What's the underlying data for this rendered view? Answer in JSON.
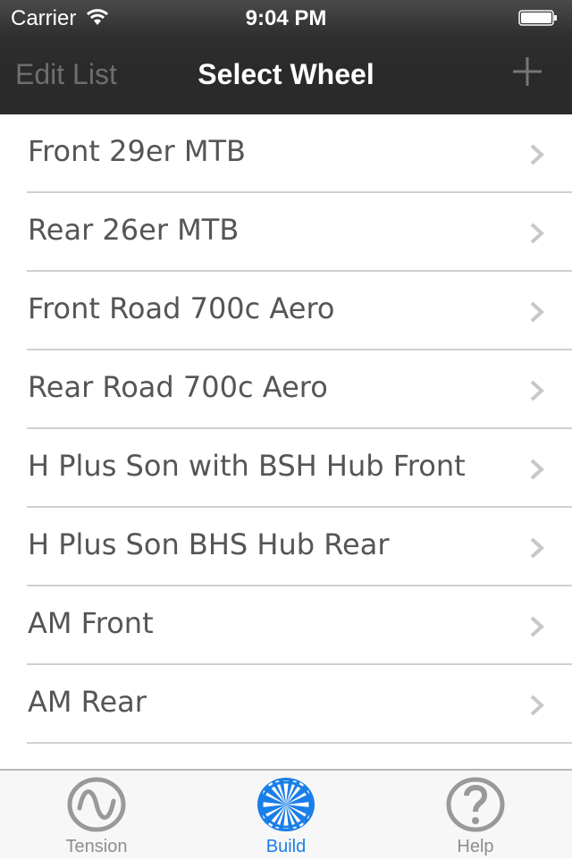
{
  "status_bar": {
    "carrier": "Carrier",
    "time": "9:04 PM",
    "wifi_icon": "wifi-icon",
    "battery_icon": "battery-icon"
  },
  "nav": {
    "left_button": "Edit List",
    "title": "Select Wheel",
    "right_icon": "plus-icon"
  },
  "wheels": [
    {
      "label": "Front 29er MTB"
    },
    {
      "label": "Rear 26er MTB"
    },
    {
      "label": "Front Road 700c Aero"
    },
    {
      "label": "Rear Road 700c Aero"
    },
    {
      "label": "H Plus Son with BSH Hub Front"
    },
    {
      "label": "H Plus Son BHS Hub Rear"
    },
    {
      "label": "AM Front"
    },
    {
      "label": "AM Rear"
    }
  ],
  "tabs": [
    {
      "label": "Tension",
      "icon": "sine-wave-icon",
      "active": false
    },
    {
      "label": "Build",
      "icon": "wheel-icon",
      "active": true
    },
    {
      "label": "Help",
      "icon": "question-icon",
      "active": false
    }
  ],
  "colors": {
    "accent": "#1a7ee8",
    "inactive": "#8e8e8e"
  }
}
